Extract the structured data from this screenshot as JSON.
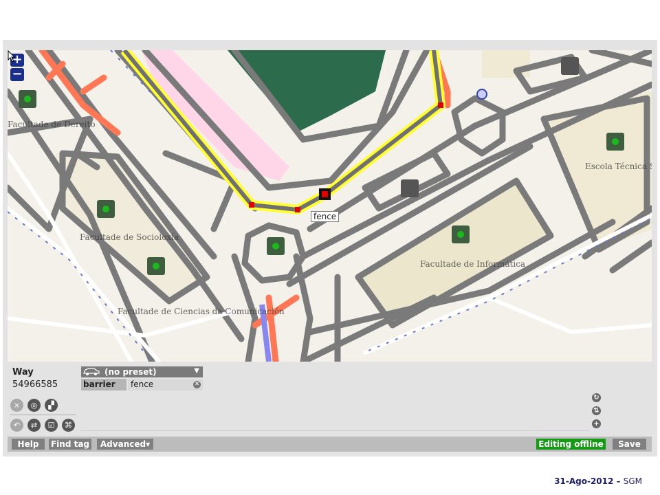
{
  "map": {
    "zoom_in": "+",
    "zoom_out": "−",
    "tooltip": "fence",
    "labels": [
      "Facultade de Dereito",
      "Facultade de Socioloxía",
      "Facultade de Ciencias da Comunicación",
      "Facultade de Informática",
      "Escola Técnica Superior de Enxeñeiros de Camiños, Canais e Portos"
    ]
  },
  "panel": {
    "entity_type": "Way",
    "entity_id": "54966585",
    "preset": "(no preset)",
    "tag_key": "barrier",
    "tag_value": "fence",
    "tools": [
      {
        "name": "quadrilateralise",
        "disabled": true
      },
      {
        "name": "circularise",
        "disabled": false
      },
      {
        "name": "straighten",
        "disabled": false
      },
      {
        "name": "undo",
        "disabled": true
      },
      {
        "name": "reverse",
        "disabled": false
      },
      {
        "name": "tick",
        "disabled": false
      },
      {
        "name": "split",
        "disabled": false
      }
    ]
  },
  "bottombar": {
    "help": "Help",
    "find_tag": "Find tag",
    "advanced": "Advanced▾",
    "status": "Editing offline",
    "save": "Save"
  },
  "footer": {
    "date": "31-Ago-2012",
    "dash": " – ",
    "author": "SGM"
  },
  "colors": {
    "selected": "#ffff33",
    "road": "#7a7a7a",
    "node": "#e00000",
    "zoom": "#1a2f8c",
    "offline": "#169a16"
  }
}
